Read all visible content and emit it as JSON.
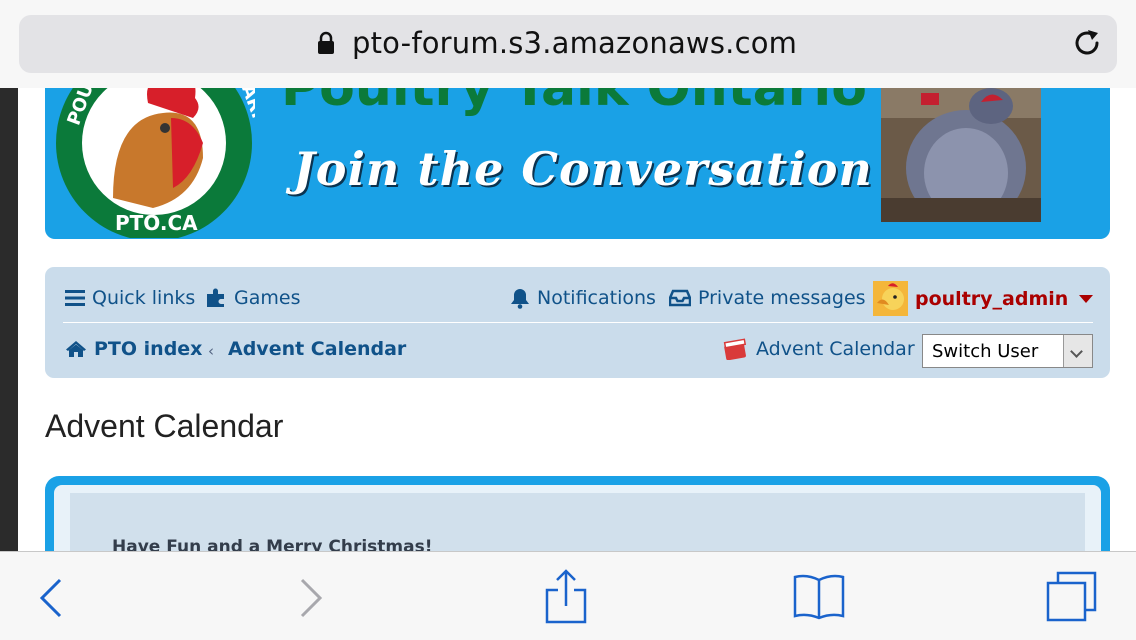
{
  "browser": {
    "url": "pto-forum.s3.amazonaws.com",
    "icons": [
      "lock-icon",
      "reload-icon"
    ]
  },
  "banner": {
    "title": "Poultry Talk Ontario",
    "tagline": "Join the Conversation",
    "logo_text_top_left": "POU",
    "logo_text_top_right": "ARIO",
    "logo_text_bottom": "PTO.CA"
  },
  "nav": {
    "quick_links": "Quick links",
    "games": "Games",
    "notifications": "Notifications",
    "private_messages": "Private messages",
    "username": "poultry_admin",
    "breadcrumb_home": "PTO index",
    "breadcrumb_current": "Advent Calendar",
    "advent_link": "Advent Calendar",
    "switch_user": "Switch User"
  },
  "page": {
    "title": "Advent Calendar",
    "content_text": "Have Fun and a Merry Christmas!"
  },
  "colors": {
    "banner_blue": "#1aa1e6",
    "nav_bg": "#cadceb",
    "link_blue": "#105289",
    "username_red": "#aa0000",
    "logo_green": "#0b7a3a",
    "ios_blue": "#1a63cc"
  },
  "toolbar_icons": [
    "back-icon",
    "forward-icon",
    "share-icon",
    "bookmarks-icon",
    "tabs-icon"
  ]
}
